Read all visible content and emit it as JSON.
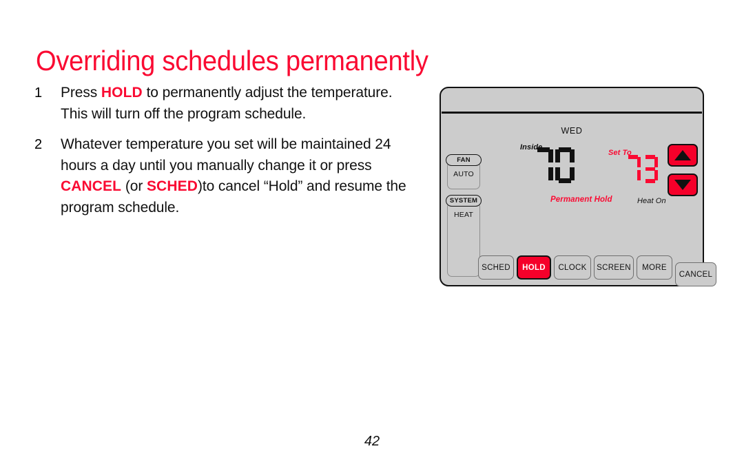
{
  "page": {
    "title": "Overriding schedules permanently",
    "number": "42",
    "accent_red": "#fa0a32",
    "body_gray": "#cccccc"
  },
  "steps": [
    {
      "number": "1",
      "parts": [
        {
          "text": "Press ",
          "style": "normal"
        },
        {
          "text": "HOLD",
          "style": "keyword"
        },
        {
          "text": " to permanently adjust the temperature. This will turn off the program schedule.",
          "style": "normal"
        }
      ]
    },
    {
      "number": "2",
      "parts": [
        {
          "text": "Whatever temperature you set will be maintained 24 hours a day until you manually change it or press ",
          "style": "normal"
        },
        {
          "text": "CANCEL",
          "style": "keyword"
        },
        {
          "text": " (or ",
          "style": "normal"
        },
        {
          "text": "SCHED",
          "style": "keyword"
        },
        {
          "text": ")to cancel “Hold” and resume the program schedule.",
          "style": "normal"
        }
      ]
    }
  ],
  "thermostat": {
    "weekday": "WED",
    "inside": {
      "label": "Inside",
      "value": "70",
      "color": "#111111"
    },
    "set_to": {
      "label": "Set To",
      "value": "73",
      "color": "#fa0a32"
    },
    "status_hold": "Permanent Hold",
    "status_heat": "Heat On",
    "left_controls": [
      {
        "pill": "FAN",
        "mode": "AUTO"
      },
      {
        "pill": "SYSTEM",
        "mode": "HEAT"
      }
    ],
    "arrows": {
      "up_icon": "triangle-up-icon",
      "down_icon": "triangle-down-icon"
    },
    "buttons": [
      {
        "label": "SCHED",
        "active": false
      },
      {
        "label": "HOLD",
        "active": true
      },
      {
        "label": "CLOCK",
        "active": false
      },
      {
        "label": "SCREEN",
        "active": false
      },
      {
        "label": "MORE",
        "active": false
      },
      {
        "label": "CANCEL",
        "active": false
      }
    ]
  }
}
